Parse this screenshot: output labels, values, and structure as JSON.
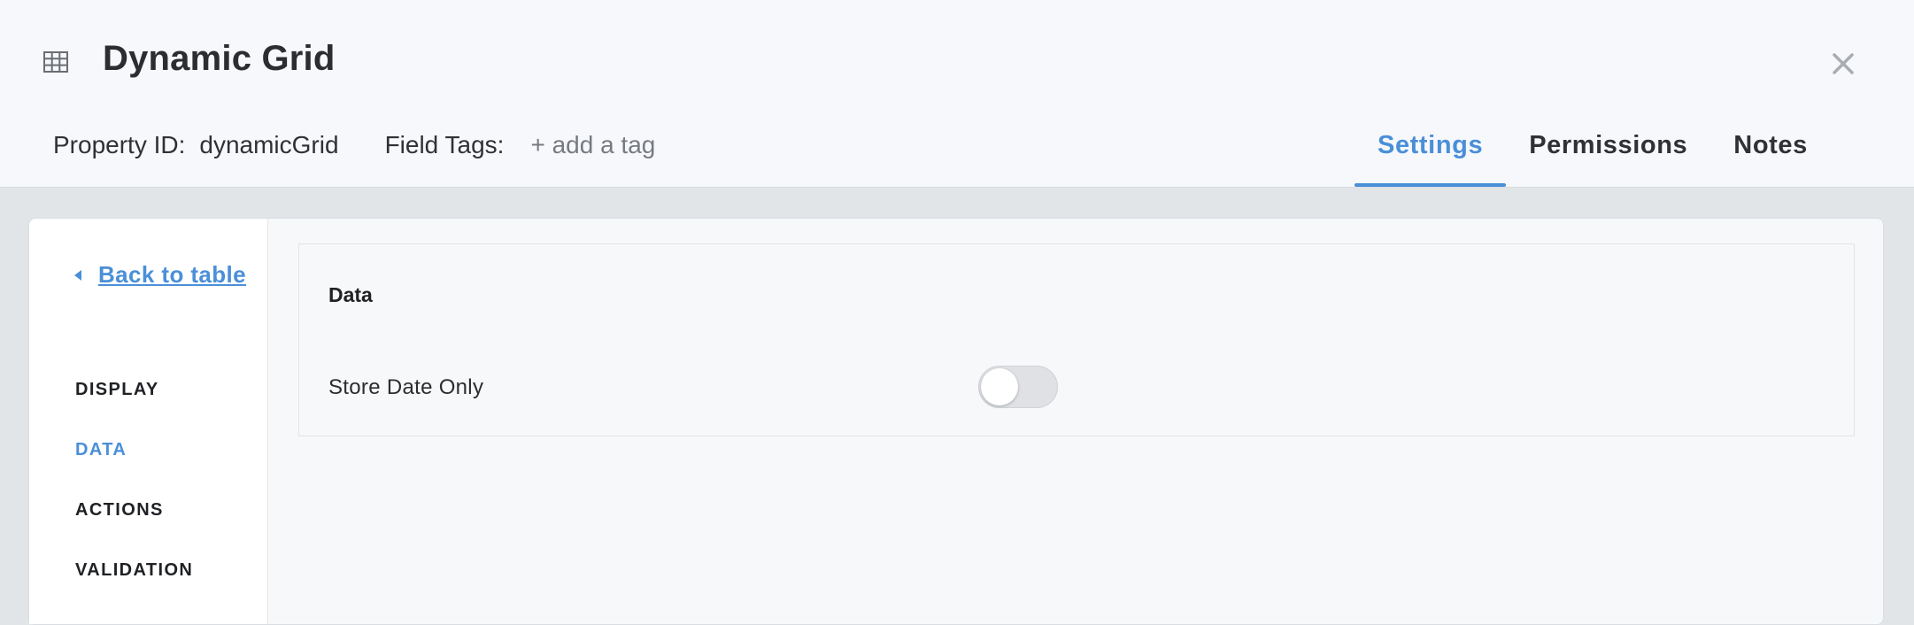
{
  "header": {
    "title": "Dynamic Grid",
    "icon": "grid-table-icon",
    "close_icon": "close-icon",
    "property_id_label": "Property ID:",
    "property_id_value": "dynamicGrid",
    "field_tags_label": "Field Tags:",
    "add_tag_label": "+ add a tag"
  },
  "tabs": [
    {
      "label": "Settings",
      "active": true
    },
    {
      "label": "Permissions",
      "active": false
    },
    {
      "label": "Notes",
      "active": false
    }
  ],
  "sidebar": {
    "back_label": "Back to table",
    "items": [
      {
        "label": "DISPLAY",
        "active": false
      },
      {
        "label": "DATA",
        "active": true
      },
      {
        "label": "ACTIONS",
        "active": false
      },
      {
        "label": "VALIDATION",
        "active": false
      }
    ]
  },
  "section": {
    "title": "Data",
    "fields": [
      {
        "label": "Store Date Only",
        "type": "toggle",
        "value": false
      }
    ]
  },
  "colors": {
    "accent": "#4a8fd8",
    "header_bg": "#f7f8fb",
    "page_bg": "#e2e5e8"
  }
}
